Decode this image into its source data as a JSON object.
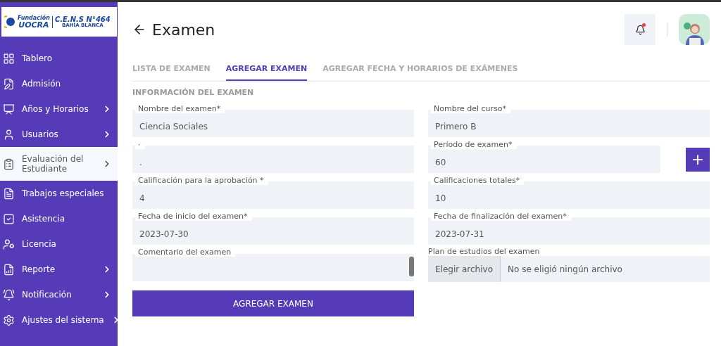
{
  "sidebar": {
    "logo": {
      "foundation_small": "Fundación",
      "foundation": "UOCRA",
      "school": "C.E.N.S N°464",
      "city": "BAHÍA BLANCA"
    },
    "items": [
      {
        "label": "Tablero",
        "has_submenu": false,
        "selected": false
      },
      {
        "label": "Admisión",
        "has_submenu": false,
        "selected": false
      },
      {
        "label": "Años y Horarios",
        "has_submenu": true,
        "selected": false
      },
      {
        "label": "Usuarios",
        "has_submenu": true,
        "selected": false
      },
      {
        "label": "Evaluación del Estudiante",
        "has_submenu": true,
        "selected": true
      },
      {
        "label": "Trabajos especiales",
        "has_submenu": false,
        "selected": false
      },
      {
        "label": "Asistencia",
        "has_submenu": false,
        "selected": false
      },
      {
        "label": "Licencia",
        "has_submenu": false,
        "selected": false
      },
      {
        "label": "Reporte",
        "has_submenu": true,
        "selected": false
      },
      {
        "label": "Notificación",
        "has_submenu": true,
        "selected": false
      },
      {
        "label": "Ajustes del sistema",
        "has_submenu": true,
        "selected": false
      }
    ]
  },
  "header": {
    "title": "Examen",
    "notification_unread": true
  },
  "tabs": [
    {
      "label": "LISTA DE EXAMEN",
      "selected": false
    },
    {
      "label": "AGREGAR EXAMEN",
      "selected": true
    },
    {
      "label": "AGREGAR FECHA Y HORARIOS DE EXÁMENES",
      "selected": false
    }
  ],
  "section_title": "INFORMACIÓN DEL EXAMEN",
  "fields": [
    {
      "kind": "text",
      "label": "Nombre del examen*",
      "value": "Ciencia Sociales"
    },
    {
      "kind": "text",
      "label": "Nombre del curso*",
      "value": "Primero B"
    },
    {
      "kind": "text",
      "label": "·",
      "value": "."
    },
    {
      "kind": "add",
      "label": "Período de examen*",
      "value": "60",
      "button": "+"
    },
    {
      "kind": "text",
      "label": "Calificación para la aprobación *",
      "value": "4"
    },
    {
      "kind": "text",
      "label": "Calificaciones totales*",
      "value": "10"
    },
    {
      "kind": "text",
      "label": "Fecha de inicio del examen*",
      "value": "2023-07-30"
    },
    {
      "kind": "text",
      "label": "Fecha de finalización del examen*",
      "value": "2023-07-31"
    },
    {
      "kind": "textarea",
      "label": "Comentario del examen"
    },
    {
      "kind": "file",
      "label": "Plan de estudios del examen",
      "button": "Elegir archivo",
      "value": "No se eligió ningún archivo"
    }
  ],
  "submit": "AGREGAR EXAMEN"
}
